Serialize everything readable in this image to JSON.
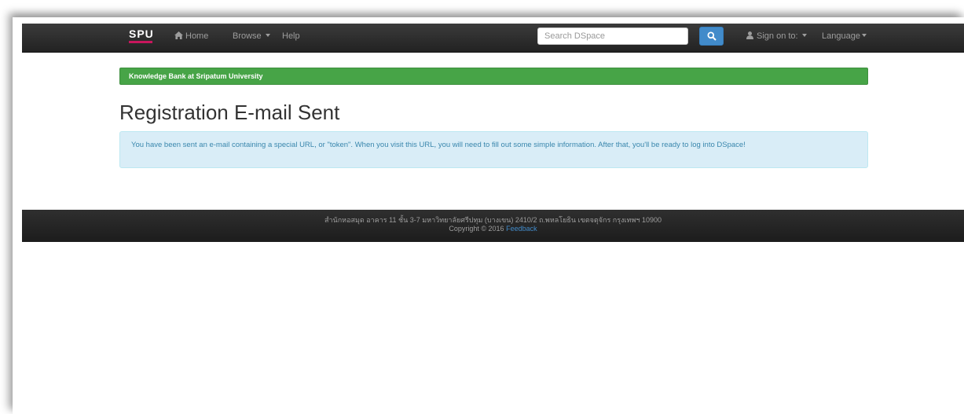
{
  "navbar": {
    "brand": "SPU",
    "home_label": "Home",
    "browse_label": "Browse",
    "help_label": "Help",
    "search_placeholder": "Search DSpace",
    "signon_label": "Sign on to:",
    "language_label": "Language"
  },
  "banner": {
    "text": "Knowledge Bank at Sripatum University"
  },
  "main": {
    "title": "Registration E-mail Sent",
    "message": "You have been sent an e-mail containing a special URL, or \"token\". When you visit this URL, you will need to fill out some simple information. After that, you'll be ready to log into DSpace!"
  },
  "footer": {
    "address": "สำนักหอสมุด อาคาร 11 ชั้น 3-7 มหาวิทยาลัยศรีปทุม (บางเขน) 2410/2 ถ.พหลโยธิน เขตจตุจักร กรุงเทพฯ 10900",
    "copyright": "Copyright © 2016",
    "feedback_label": "Feedback"
  },
  "colors": {
    "navbar_bg": "#222222",
    "brand_accent": "#c8175d",
    "banner_bg": "#47a447",
    "info_bg": "#d9edf7",
    "info_text": "#3a87ad",
    "link": "#428bca"
  },
  "icons": {
    "home": "home-icon",
    "search": "search-icon",
    "user": "user-icon",
    "dropdown": "caret-down-icon"
  }
}
